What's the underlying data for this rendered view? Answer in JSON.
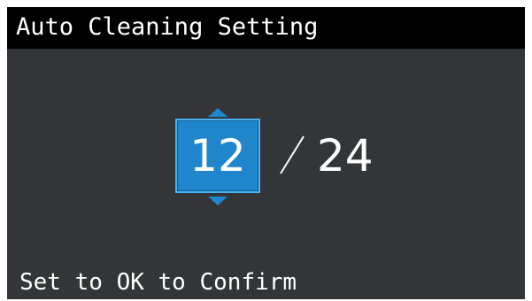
{
  "title_bar": {
    "title": "Auto Cleaning Setting"
  },
  "counter": {
    "value": "12",
    "separator_icon": "slash-icon",
    "total": "24",
    "up_icon": "arrow-up-icon",
    "down_icon": "arrow-down-icon"
  },
  "footer": {
    "hint": "Set to OK to Confirm"
  },
  "colors": {
    "screen_background": "#333538",
    "title_background": "#000000",
    "selection_accent": "#1f86cc",
    "text": "#ffffff"
  }
}
